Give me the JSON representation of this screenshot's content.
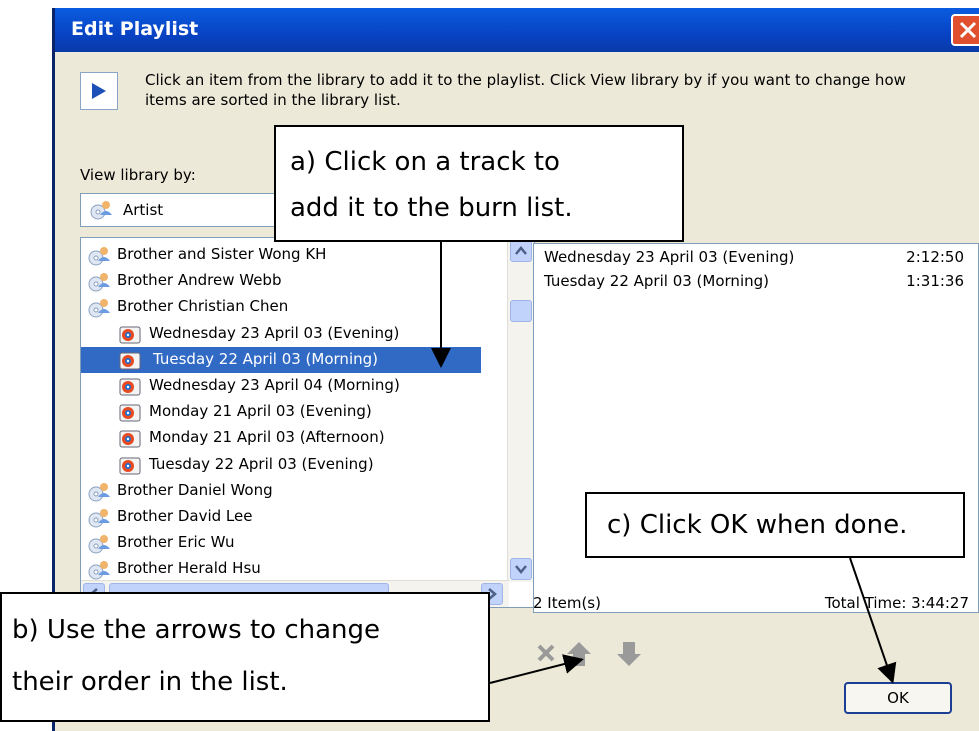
{
  "window": {
    "title": "Edit Playlist"
  },
  "instructions": "Click an item from the library to add it to the playlist. Click View library by if you want to change how items are sorted in the library list.",
  "view_library": {
    "label": "View library by:",
    "selected": "Artist"
  },
  "library": {
    "items": [
      {
        "label": "Brother and Sister Wong KH",
        "type": "artist"
      },
      {
        "label": "Brother Andrew Webb",
        "type": "artist"
      },
      {
        "label": "Brother Christian Chen",
        "type": "artist"
      },
      {
        "label": "Wednesday 23 April 03 (Evening)",
        "type": "track"
      },
      {
        "label": "Tuesday 22 April 03 (Morning)",
        "type": "track",
        "selected": true
      },
      {
        "label": "Wednesday 23 April 04 (Morning)",
        "type": "track"
      },
      {
        "label": "Monday 21 April 03 (Evening)",
        "type": "track"
      },
      {
        "label": "Monday 21 April 03 (Afternoon)",
        "type": "track"
      },
      {
        "label": "Tuesday 22 April 03 (Evening)",
        "type": "track"
      },
      {
        "label": "Brother Daniel Wong",
        "type": "artist"
      },
      {
        "label": "Brother David Lee",
        "type": "artist"
      },
      {
        "label": "Brother Eric Wu",
        "type": "artist"
      },
      {
        "label": "Brother Herald Hsu",
        "type": "artist"
      }
    ]
  },
  "playlist": {
    "items": [
      {
        "title": "Wednesday 23 April 03 (Evening)",
        "duration": "2:12:50"
      },
      {
        "title": "Tuesday 22 April 03 (Morning)",
        "duration": "1:31:36"
      }
    ],
    "count": "2 Item(s)",
    "total": "Total Time: 3:44:27"
  },
  "buttons": {
    "ok": "OK"
  },
  "icons": {
    "close": "close-icon",
    "info": "play-info-icon",
    "artist": "artist-icon",
    "track": "track-icon",
    "remove": "remove-icon",
    "move_up": "move-up-icon",
    "move_down": "move-down-icon"
  },
  "callouts": {
    "a_line1": "a) Click on a track to",
    "a_line2": "add it to the burn list.",
    "b_line1": "b) Use the arrows to change",
    "b_line2": "their order in the list.",
    "c": "c) Click OK when done."
  },
  "colors": {
    "titlebar": "#0a5ce0",
    "selection": "#316ac5",
    "dialog_bg": "#ece9d8"
  }
}
